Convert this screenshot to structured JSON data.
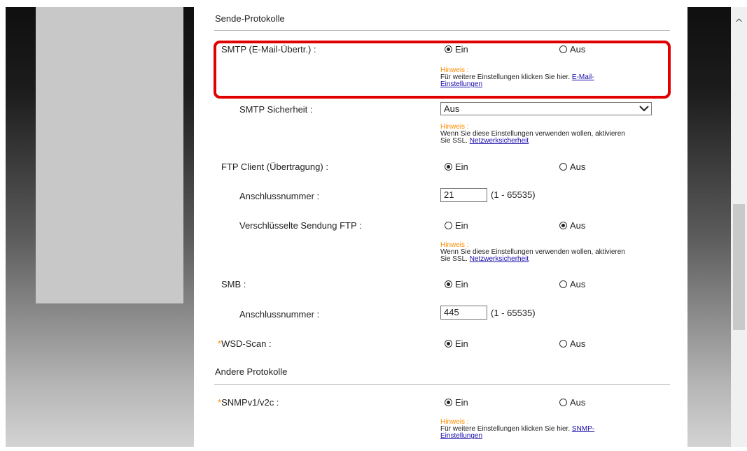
{
  "sections": {
    "send_protocols": "Sende-Protokolle",
    "other_protocols": "Andere Protokolle"
  },
  "common": {
    "on": "Ein",
    "off": "Aus",
    "hint_title": "Hinweis :"
  },
  "rows": {
    "smtp": {
      "label": "SMTP (E-Mail-Übertr.) :",
      "selected": "Ein",
      "hint_text": "Für weitere Einstellungen klicken Sie hier.",
      "hint_link_1": "E-Mail-",
      "hint_link_2": "Einstellungen"
    },
    "smtp_security": {
      "label": "SMTP Sicherheit :",
      "value": "Aus",
      "hint_text_1": "Wenn Sie diese Einstellungen verwenden wollen, aktivieren",
      "hint_text_2": "Sie SSL.",
      "hint_link": "Netzwerksicherheit"
    },
    "ftp_client": {
      "label": "FTP Client (Übertragung) :",
      "selected": "Ein"
    },
    "ftp_port": {
      "label": "Anschlussnummer :",
      "value": "21",
      "range": "(1 - 65535)"
    },
    "ftp_encrypted": {
      "label": "Verschlüsselte Sendung FTP :",
      "selected": "Aus",
      "hint_text_1": "Wenn Sie diese Einstellungen verwenden wollen, aktivieren",
      "hint_text_2": "Sie SSL.",
      "hint_link": "Netzwerksicherheit"
    },
    "smb": {
      "label": "SMB :",
      "selected": "Ein"
    },
    "smb_port": {
      "label": "Anschlussnummer :",
      "value": "445",
      "range": "(1 - 65535)"
    },
    "wsd_scan": {
      "required_mark": "*",
      "label": "WSD-Scan :",
      "selected": "Ein"
    },
    "snmp": {
      "required_mark": "*",
      "label": "SNMPv1/v2c :",
      "selected": "Ein",
      "hint_text": "Für weitere Einstellungen klicken Sie hier.",
      "hint_link_1": "SNMP-",
      "hint_link_2": "Einstellungen"
    }
  },
  "colors": {
    "highlight": "#e00000",
    "hint_title": "#ff8c00",
    "link": "#1a0dab"
  }
}
